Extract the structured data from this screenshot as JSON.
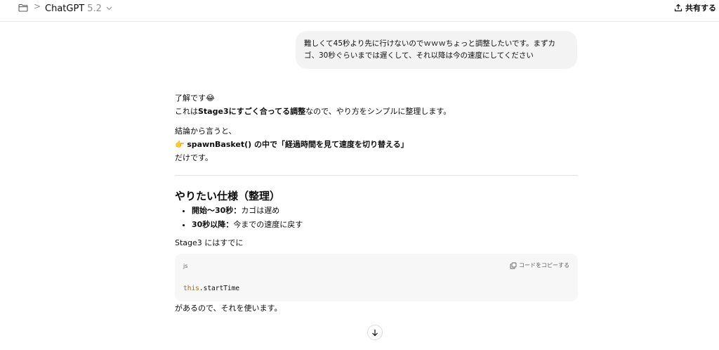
{
  "header": {
    "model_name": "ChatGPT",
    "model_version": "5.2",
    "breadcrumb_separator": ">",
    "share_label": "共有する"
  },
  "user_message": {
    "text": "難しくて45秒より先に行けないのでｗｗｗちょっと調整したいです。まずカゴ、30秒ぐらいまでは遅くして、それ以降は今の速度にしてください"
  },
  "assistant": {
    "line1_text": "了解です",
    "line1_emoji": "😂",
    "line2_prefix": "これは",
    "line2_bold": "Stage3にすごく合ってる調整",
    "line2_suffix": "なので、やり方をシンプルに整理します。",
    "conclusion_intro": "結論から言うと、",
    "conclusion_emoji": "👉",
    "conclusion_bold": "spawnBasket() の中で「経過時間を見て速度を切り替える」",
    "conclusion_tail": "だけです。",
    "section_heading": "やりたい仕様（整理）",
    "spec_items": [
      {
        "bold": "開始〜30秒：",
        "text": "カゴは遅め"
      },
      {
        "bold": "30秒以降：",
        "text": "今までの速度に戻す"
      }
    ],
    "pre_code_text": "Stage3 にはすでに",
    "code": {
      "language": "js",
      "copy_label": "コードをコピーする",
      "keyword": "this",
      "rest": ".startTime"
    },
    "post_code_text": "があるので、それを使います。"
  }
}
